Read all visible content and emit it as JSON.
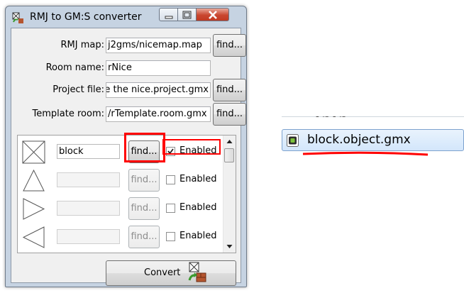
{
  "window": {
    "title": "RMJ to GM:S converter",
    "icon": "converter-app-icon"
  },
  "form": {
    "rmj_map": {
      "label": "RMJ map:",
      "value": "j2gms/nicemap.map",
      "find_label": "find..."
    },
    "room_name": {
      "label": "Room name:",
      "value": "rNice"
    },
    "project_file": {
      "label": "Project file:",
      "value": "e the nice.project.gmx",
      "find_label": "find..."
    },
    "template_room": {
      "label": "Template room:",
      "value": "/rTemplate.room.gmx",
      "find_label": "find..."
    }
  },
  "objects": [
    {
      "shape": "crossed-square-icon",
      "name": "block",
      "find_label": "find...",
      "checked": true,
      "enabled_label": "Enabled",
      "disabled": false
    },
    {
      "shape": "triangle-up-icon",
      "name": "",
      "find_label": "find...",
      "checked": false,
      "enabled_label": "Enabled",
      "disabled": true
    },
    {
      "shape": "triangle-right-icon",
      "name": "",
      "find_label": "find...",
      "checked": false,
      "enabled_label": "Enabled",
      "disabled": true
    },
    {
      "shape": "triangle-left-icon",
      "name": "",
      "find_label": "find...",
      "checked": false,
      "enabled_label": "Enabled",
      "disabled": true
    }
  ],
  "convert": {
    "label": "Convert"
  },
  "file_snippet": {
    "top_fragment": "- ~ - ~",
    "file_name": "block.object.gmx",
    "icon": "gmx-object-file-icon"
  },
  "colors": {
    "highlight": "#ff0000",
    "selection": "#d3e6fb"
  }
}
